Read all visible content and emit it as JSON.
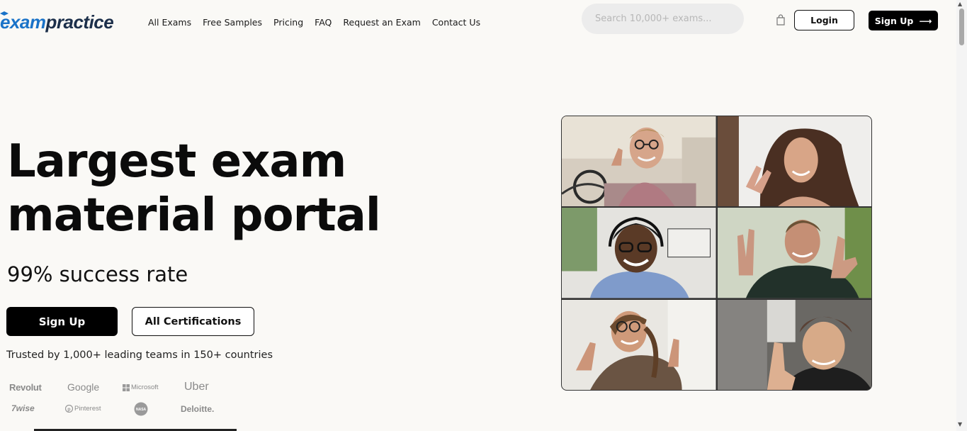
{
  "logo": {
    "part1": "exam",
    "part2": "practice"
  },
  "nav": {
    "items": [
      {
        "label": "All Exams"
      },
      {
        "label": "Free Samples"
      },
      {
        "label": "Pricing"
      },
      {
        "label": "FAQ"
      },
      {
        "label": "Request an Exam"
      },
      {
        "label": "Contact Us"
      }
    ]
  },
  "search": {
    "placeholder": "Search 10,000+ exams..."
  },
  "header": {
    "cart_icon": "shopping-bag-icon",
    "login_label": "Login",
    "signup_label": "Sign Up",
    "signup_arrow": "⟶"
  },
  "hero": {
    "title_line1": "Largest exam",
    "title_line2": "material portal",
    "subtitle": "99% success rate",
    "primary_button": "Sign Up",
    "secondary_button": "All Certifications",
    "trusted_text": "Trusted by 1,000+ leading teams in 150+ countries"
  },
  "brands": {
    "revolut": "Revolut",
    "google": "Google",
    "microsoft": "Microsoft",
    "uber": "Uber",
    "wise": "7wise",
    "pinterest": "Pinterest",
    "nasa": "NASA",
    "deloitte": "Deloitte."
  },
  "video_grid": {
    "tiles": [
      {
        "name": "man-with-glasses-thumbs-up"
      },
      {
        "name": "woman-peace-sign"
      },
      {
        "name": "person-headphones-smiling"
      },
      {
        "name": "man-rock-gesture"
      },
      {
        "name": "woman-thumbs-up"
      },
      {
        "name": "person-beanie-thumbs-up"
      }
    ]
  },
  "colors": {
    "accent": "#1a73c8",
    "logo_dark": "#1c2f4a",
    "background": "#faf9f6",
    "button": "#000000"
  }
}
